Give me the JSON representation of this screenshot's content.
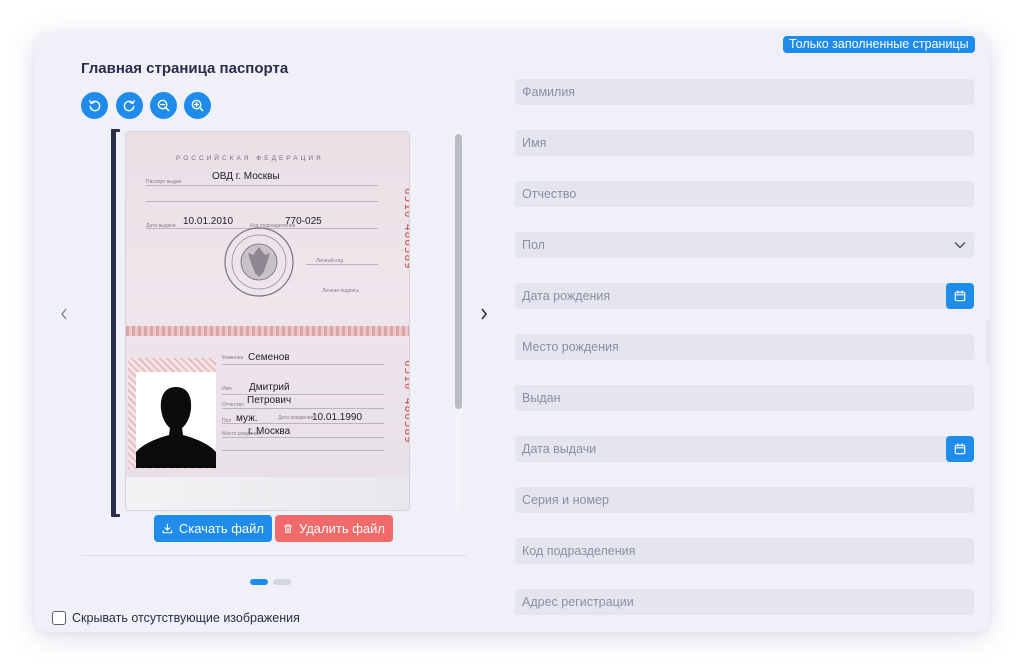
{
  "header": {
    "filled_only_label": "Только заполненные страницы",
    "section_title": "Главная страница паспорта"
  },
  "toolbar": {
    "icons": [
      "rotate-left-icon",
      "rotate-right-icon",
      "zoom-out-icon",
      "zoom-in-icon"
    ]
  },
  "document": {
    "country": "РОССИЙСКАЯ ФЕДЕРАЦИЯ",
    "issued_by_caption": "Паспорт выдан",
    "issued_by": "ОВД г. Москвы",
    "issue_date_caption": "Дата выдачи",
    "issue_date": "10.01.2010",
    "dept_code_caption": "Код подразделения",
    "dept_code": "770-025",
    "signature_caption": "Личный код",
    "holder_sign_caption": "Личная подпись",
    "series_top": "6510",
    "number_top": "486589",
    "surname_caption": "Фамилия",
    "surname": "Семенов",
    "name_caption": "Имя",
    "name": "Дмитрий",
    "patronymic_caption": "Отчество",
    "patronymic": "Петрович",
    "sex_caption": "Пол",
    "sex": "муж.",
    "dob_caption": "Дата рождения",
    "dob": "10.01.1990",
    "pob_caption": "Место рождения",
    "pob": "г. Москва",
    "series_bottom": "6510",
    "number_bottom": "486589"
  },
  "actions": {
    "download_label": "Скачать файл",
    "delete_label": "Удалить файл"
  },
  "pagination": {
    "current": 1,
    "total": 2
  },
  "hide_missing_label": "Скрывать отсутствующие изображения",
  "form": {
    "fields": [
      {
        "placeholder": "Фамилия"
      },
      {
        "placeholder": "Имя"
      },
      {
        "placeholder": "Отчество"
      },
      {
        "placeholder": "Пол"
      },
      {
        "placeholder": "Дата рождения"
      },
      {
        "placeholder": "Место рождения"
      },
      {
        "placeholder": "Выдан"
      },
      {
        "placeholder": "Дата выдачи"
      },
      {
        "placeholder": "Серия и номер"
      },
      {
        "placeholder": "Код подразделения"
      },
      {
        "placeholder": "Адрес регистрации"
      }
    ]
  },
  "colors": {
    "accent": "#1f8bea",
    "danger": "#f16a6a",
    "text": "#2a2d4a",
    "field_bg": "#e4e5ef"
  }
}
